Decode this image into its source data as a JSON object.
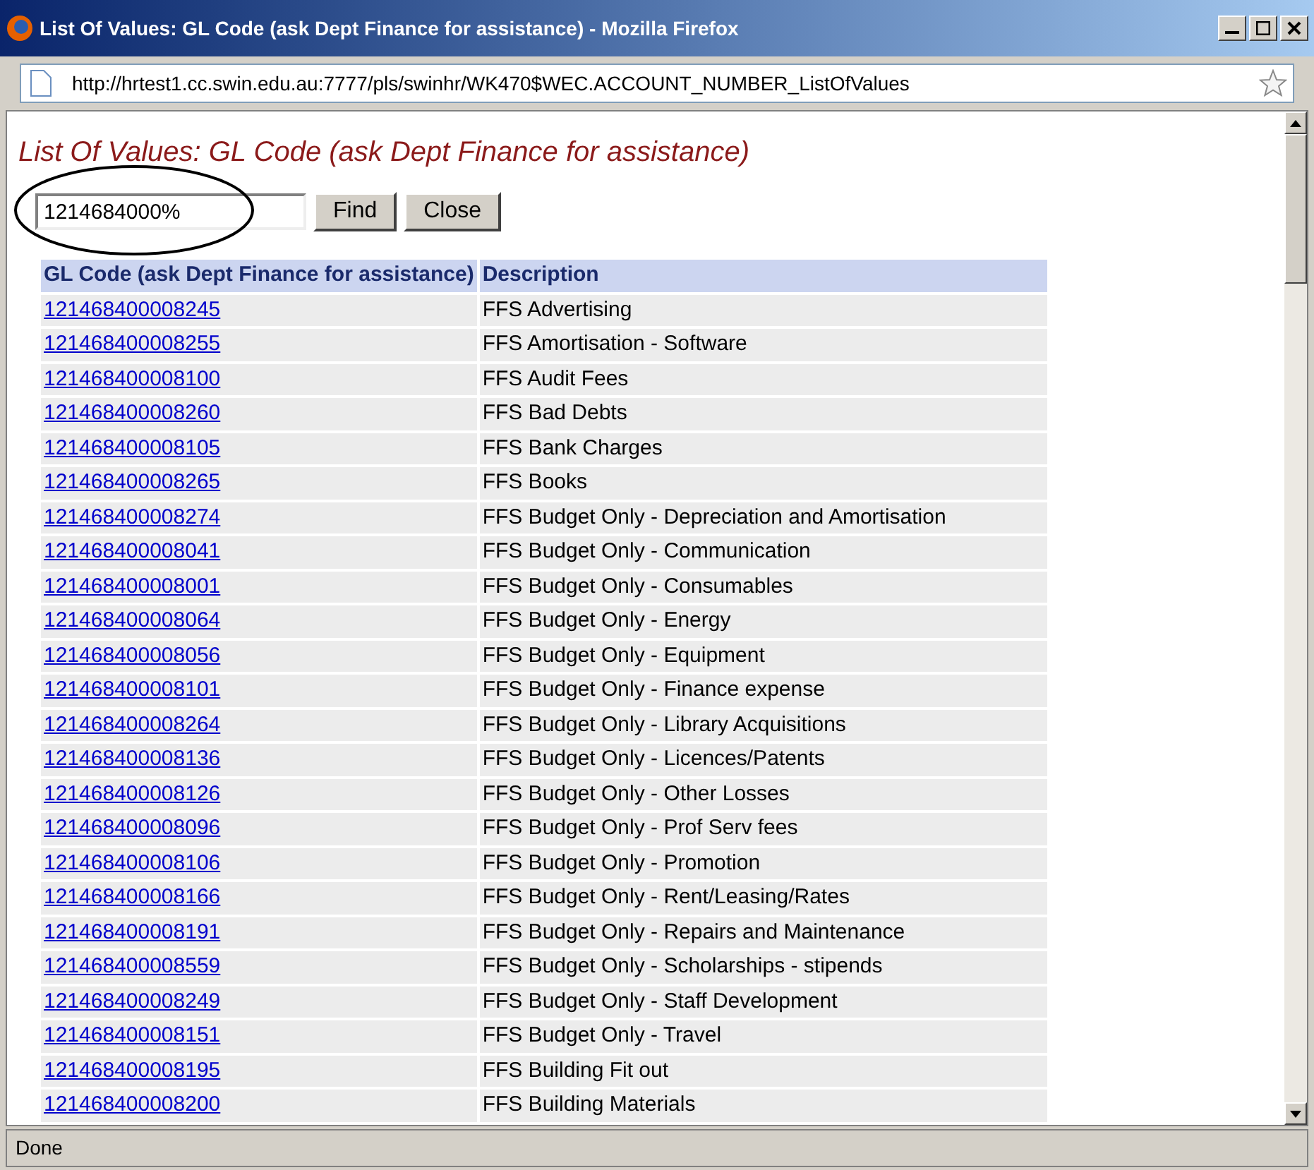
{
  "window": {
    "title": "List Of Values: GL Code (ask Dept Finance for assistance) - Mozilla Firefox"
  },
  "address_bar": {
    "url": "http://hrtest1.cc.swin.edu.au:7777/pls/swinhr/WK470$WEC.ACCOUNT_NUMBER_ListOfValues"
  },
  "page": {
    "heading": "List Of Values: GL Code (ask Dept Finance for assistance)",
    "search": {
      "value": "1214684000%"
    },
    "buttons": [
      "Find",
      "Close"
    ],
    "table": {
      "columns": [
        "GL Code (ask Dept Finance for assistance)",
        "Description"
      ],
      "rows": [
        [
          "121468400008245",
          "FFS Advertising"
        ],
        [
          "121468400008255",
          "FFS Amortisation - Software"
        ],
        [
          "121468400008100",
          "FFS Audit Fees"
        ],
        [
          "121468400008260",
          "FFS Bad Debts"
        ],
        [
          "121468400008105",
          "FFS Bank Charges"
        ],
        [
          "121468400008265",
          "FFS Books"
        ],
        [
          "121468400008274",
          "FFS Budget Only - Depreciation and Amortisation"
        ],
        [
          "121468400008041",
          "FFS Budget Only - Communication"
        ],
        [
          "121468400008001",
          "FFS Budget Only - Consumables"
        ],
        [
          "121468400008064",
          "FFS Budget Only - Energy"
        ],
        [
          "121468400008056",
          "FFS Budget Only - Equipment"
        ],
        [
          "121468400008101",
          "FFS Budget Only - Finance expense"
        ],
        [
          "121468400008264",
          "FFS Budget Only - Library Acquisitions"
        ],
        [
          "121468400008136",
          "FFS Budget Only - Licences/Patents"
        ],
        [
          "121468400008126",
          "FFS Budget Only - Other Losses"
        ],
        [
          "121468400008096",
          "FFS Budget Only - Prof Serv fees"
        ],
        [
          "121468400008106",
          "FFS Budget Only - Promotion"
        ],
        [
          "121468400008166",
          "FFS Budget Only - Rent/Leasing/Rates"
        ],
        [
          "121468400008191",
          "FFS Budget Only - Repairs and Maintenance"
        ],
        [
          "121468400008559",
          "FFS Budget Only - Scholarships - stipends"
        ],
        [
          "121468400008249",
          "FFS Budget Only - Staff Development"
        ],
        [
          "121468400008151",
          "FFS Budget Only - Travel"
        ],
        [
          "121468400008195",
          "FFS Building Fit out"
        ],
        [
          "121468400008200",
          "FFS Building Materials"
        ]
      ]
    }
  },
  "status_bar": {
    "text": "Done"
  }
}
